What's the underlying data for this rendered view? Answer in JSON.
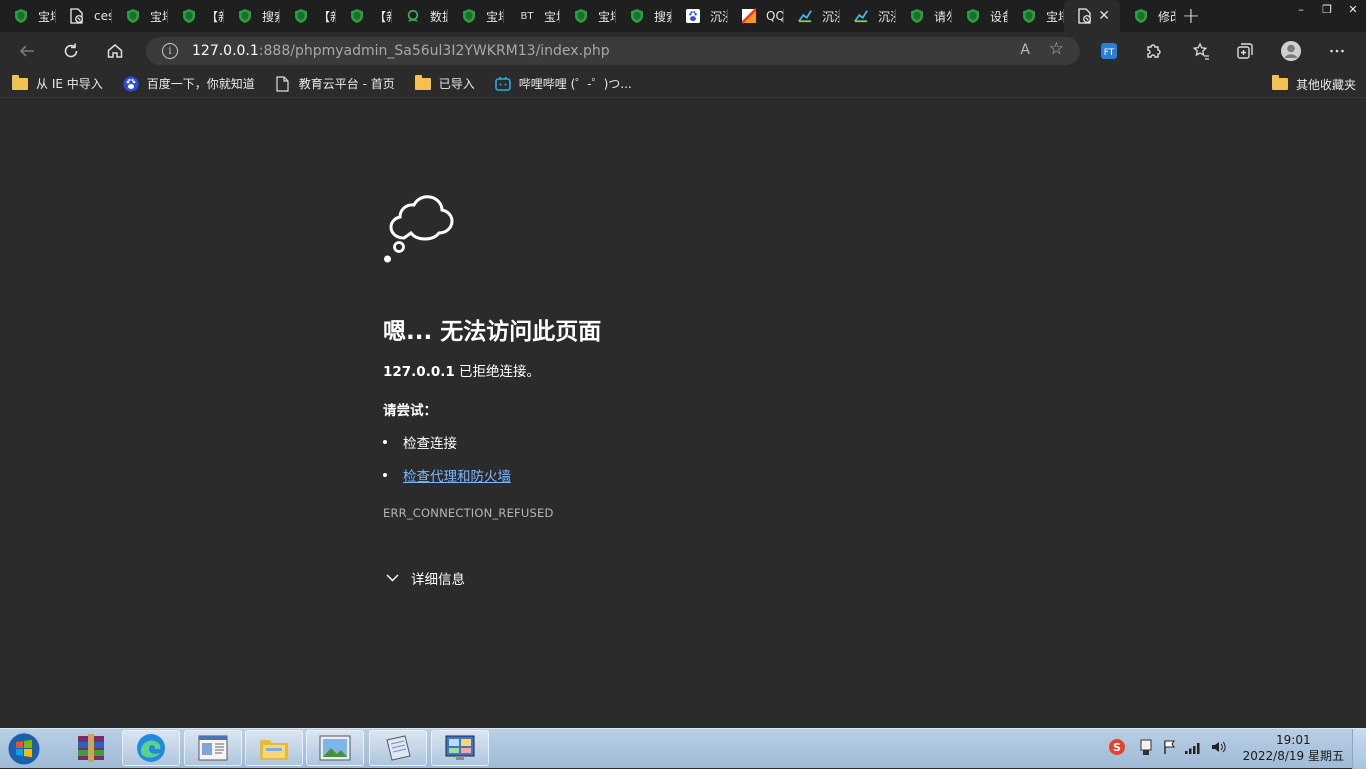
{
  "browser": {
    "tabs": [
      {
        "label": "宝塔",
        "icon": "shield-icon"
      },
      {
        "label": "ces.",
        "icon": "file-error-icon"
      },
      {
        "label": "宝塔",
        "icon": "shield-icon"
      },
      {
        "label": "【新",
        "icon": "shield-icon"
      },
      {
        "label": "搜索",
        "icon": "shield-icon"
      },
      {
        "label": "【新",
        "icon": "shield-icon"
      },
      {
        "label": "【新",
        "icon": "shield-icon"
      },
      {
        "label": "数据",
        "icon": "webmaster-icon"
      },
      {
        "label": "宝塔",
        "icon": "shield-icon"
      },
      {
        "label": "宝塔",
        "icon": "bt-icon",
        "badge": "BT"
      },
      {
        "label": "宝塔",
        "icon": "shield-icon"
      },
      {
        "label": "搜索",
        "icon": "shield-icon"
      },
      {
        "label": "沉浸",
        "icon": "baidu-icon"
      },
      {
        "label": "QQ",
        "icon": "qq-mail-icon"
      },
      {
        "label": "沉浸",
        "icon": "chart-icon"
      },
      {
        "label": "沉浸",
        "icon": "chart-icon"
      },
      {
        "label": "请勿",
        "icon": "shield-icon"
      },
      {
        "label": "设备",
        "icon": "shield-icon"
      },
      {
        "label": "宝塔",
        "icon": "shield-icon"
      },
      {
        "label": "",
        "icon": "file-error-icon",
        "active": true
      },
      {
        "label": "修改",
        "icon": "shield-icon"
      }
    ],
    "new_tab": "+",
    "window_controls": [
      "–",
      "❐",
      "✕"
    ],
    "close_tab": "✕"
  },
  "address": {
    "host": "127.0.0.1",
    "path": ":888/phpmyadmin_Sa56ul3I2YWKRM13/index.php",
    "read_aloud": "A",
    "favorite": "☆"
  },
  "bookmarks": [
    {
      "label": "从 IE 中导入",
      "icon": "folder-icon"
    },
    {
      "label": "百度一下，你就知道",
      "icon": "baidu-icon"
    },
    {
      "label": "教育云平台 - 首页",
      "icon": "page-icon"
    },
    {
      "label": "已导入",
      "icon": "folder-icon"
    },
    {
      "label": "哔哩哔哩 (゜-゜)つ...",
      "icon": "bilibili-icon"
    }
  ],
  "bookmarks_other": "其他收藏夹",
  "error": {
    "title": "嗯... 无法访问此页面",
    "host": "127.0.0.1",
    "refused": " 已拒绝连接。",
    "try_label": "请尝试：",
    "suggestions": [
      "检查连接",
      "检查代理和防火墙"
    ],
    "code": "ERR_CONNECTION_REFUSED",
    "details": "详细信息"
  },
  "taskbar": {
    "time": "19:01",
    "date": "2022/8/19 星期五"
  },
  "colors": {
    "background": "#2b2b2b",
    "link": "#7cb8ff",
    "shield_green": "#2e9e45"
  }
}
